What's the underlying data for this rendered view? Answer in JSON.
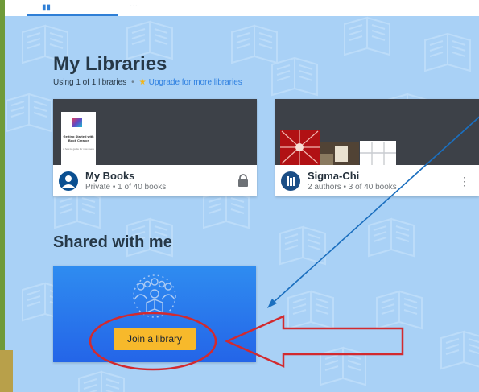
{
  "tabs": {
    "label_glyph": "▮▮",
    "second_label": "···"
  },
  "my_libraries": {
    "title": "My Libraries",
    "usage": "Using 1 of 1 libraries",
    "separator": "•",
    "upgrade_text": "Upgrade for more libraries",
    "cards": [
      {
        "name": "My Books",
        "meta": "Private • 1 of 40 books",
        "avatar_initial": "👤",
        "book_title": "Getting Started with Book Creator",
        "book_sub": "A how-to guide for new users",
        "icon": "lock-icon"
      },
      {
        "name": "Sigma-Chi",
        "meta": "2 authors • 3 of 40 books",
        "avatar_initial": "▙",
        "icon": "more-vert-icon",
        "menu_glyph": "⋮"
      }
    ]
  },
  "shared": {
    "title": "Shared with me",
    "join_label": "Join a library"
  },
  "colors": {
    "background": "#a9d1f6",
    "accent": "#2f7fd6",
    "join_button": "#f7b92b",
    "annotation_red": "#d22a2f",
    "annotation_blue": "#1b6fbf"
  }
}
